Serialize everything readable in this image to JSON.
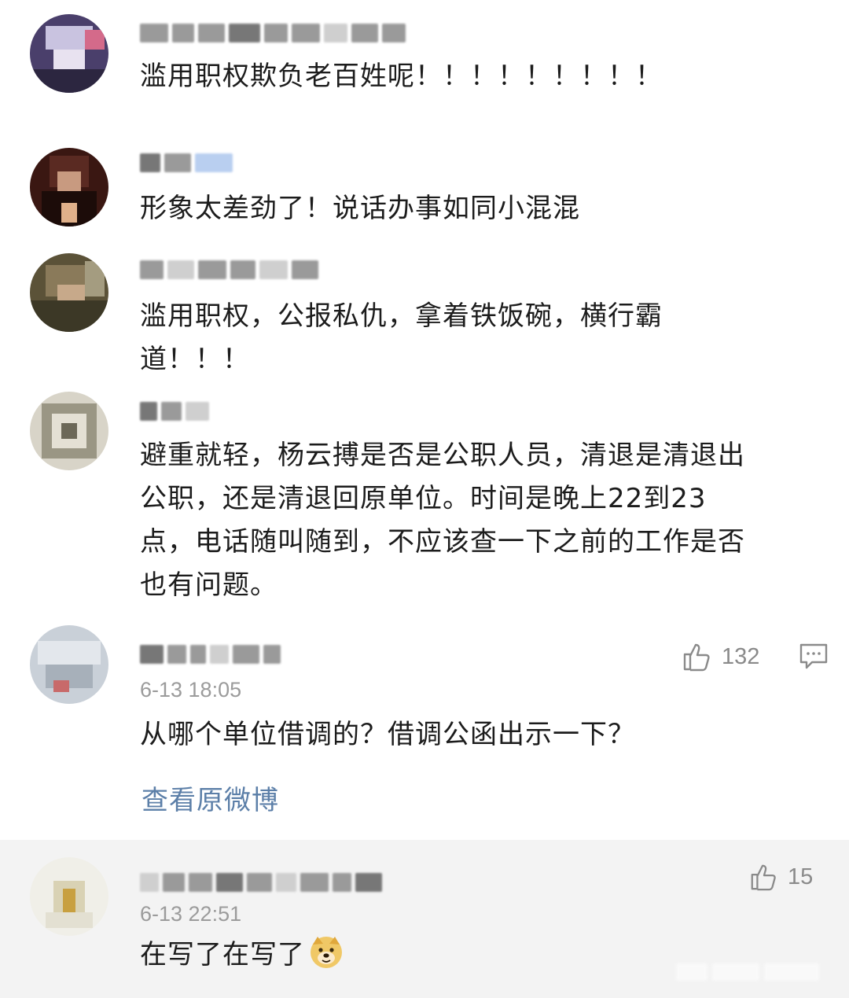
{
  "comments": [
    {
      "text": "滥用职权欺负老百姓呢！！！！！！！！！"
    },
    {
      "text": "形象太差劲了！说话办事如同小混混"
    },
    {
      "text_line1": "滥用职权，公报私仇，拿着铁饭碗，横行霸",
      "text_line2": "道！！！"
    },
    {
      "lines": [
        "避重就轻，杨云搏是否是公职人员，清退是清退出",
        "公职，还是清退回原单位。时间是晚上22到23",
        "点，电话随叫随到，不应该查一下之前的工作是否",
        "也有问题。"
      ]
    },
    {
      "likes": "132",
      "timestamp": "6-13 18:05",
      "text": "从哪个单位借调的？借调公函出示一下？",
      "view_original": "查看原微博"
    },
    {
      "likes": "15",
      "timestamp": "6-13 22:51",
      "text": "在写了在写了",
      "emoji": "doge-emoji"
    }
  ],
  "icons": {
    "like": "thumbs-up-icon",
    "reply": "comment-icon"
  },
  "colors": {
    "link": "#5c7fa8",
    "timestamp": "#9b9b9b",
    "reply_bg": "#f3f3f3"
  }
}
